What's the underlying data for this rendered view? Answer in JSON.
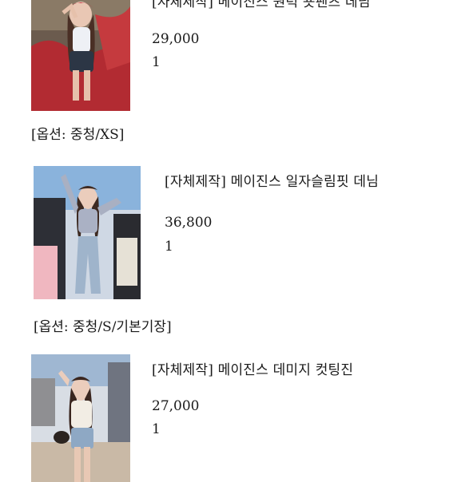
{
  "items": [
    {
      "title": "[자체제작] 메이진스 원턱 숏팬츠 데님",
      "price": "29,000",
      "qty": "1",
      "option": "[옵션: 중청/XS]"
    },
    {
      "title": "[자체제작] 메이진스 일자슬림핏 데님",
      "price": "36,800",
      "qty": "1",
      "option": "[옵션: 중청/S/기본기장]"
    },
    {
      "title": "[자체제작] 메이진스 데미지 컷팅진",
      "price": "27,000",
      "qty": "1"
    }
  ]
}
